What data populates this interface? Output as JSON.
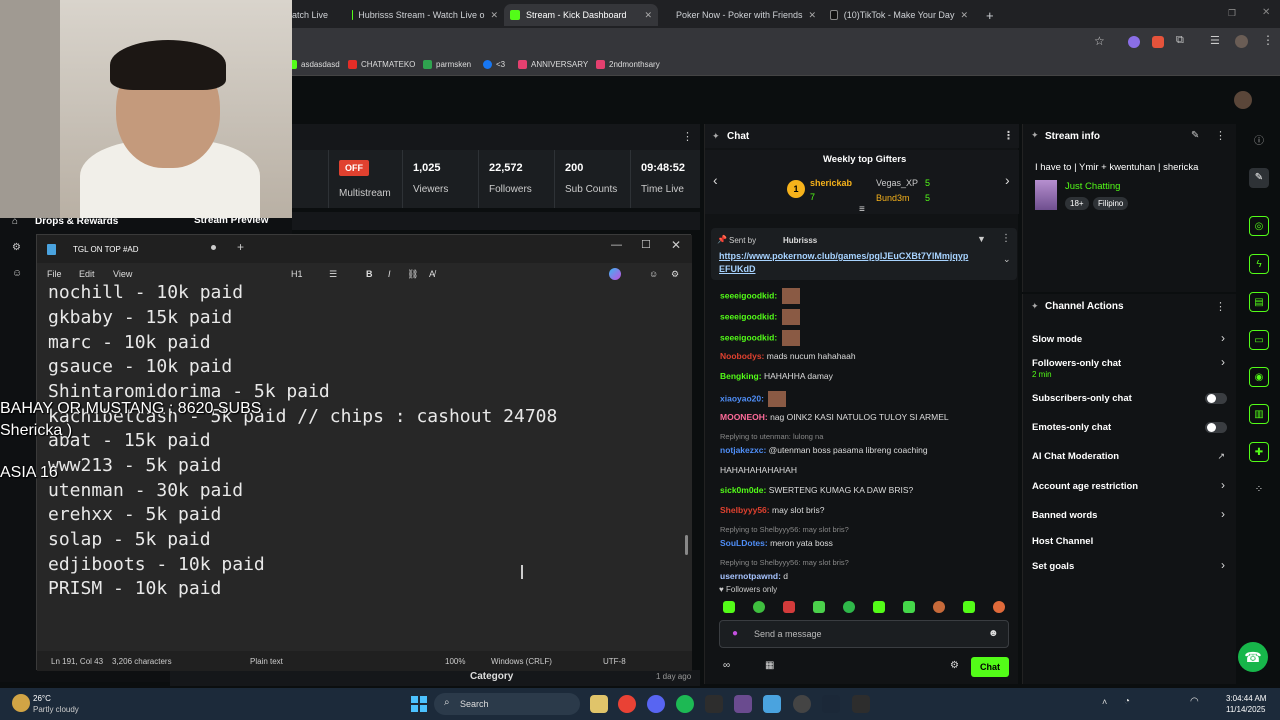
{
  "browser": {
    "tabs": [
      {
        "label": "atch Live",
        "color": "#53fc18"
      },
      {
        "label": "Hubrisss Stream - Watch Live o",
        "color": "#53fc18"
      },
      {
        "label": "Stream - Kick Dashboard",
        "color": "#53fc18"
      },
      {
        "label": "Poker Now - Poker with Friends",
        "color": "#222"
      },
      {
        "label": "(10)TikTok - Make Your Day",
        "color": "#111"
      }
    ],
    "new_tab": "+",
    "bookmarks": [
      "asdasdasd",
      "CHATMATEKO",
      "parmsken",
      "<3",
      "ANNIVERSARY",
      "2ndmonthsary"
    ]
  },
  "dashboard": {
    "drops": "Drops & Rewards",
    "stream_preview": "Stream Preview",
    "offline_badge": "OFF",
    "multistream": "Multistream",
    "stats": [
      {
        "value": "1,025",
        "label": "Viewers"
      },
      {
        "value": "22,572",
        "label": "Followers"
      },
      {
        "value": "200",
        "label": "Sub Counts"
      },
      {
        "value": "09:48:52",
        "label": "Time Live"
      }
    ],
    "category": "Category",
    "time_ago": "1 day ago"
  },
  "overlay": {
    "line1": "BAHAY OR MUSTANG : 8620 SUBS",
    "line2": "Shericka )",
    "line3": "ASIA 16"
  },
  "notepad": {
    "tab_title": "TGL ON TOP #AD",
    "menu": [
      "File",
      "Edit",
      "View"
    ],
    "heading": "H1",
    "lines": [
      "nochill - 10k paid",
      "gkbaby - 15k paid",
      "marc - 10k paid",
      "gsauce - 10k paid",
      "Shintaromidorima - 5k paid",
      "kachibetcash - 5k paid // chips : cashout 24708",
      "abat - 15k paid",
      "www213 - 5k paid",
      "utenman - 30k paid",
      "erehxx - 5k paid",
      "solap - 5k paid",
      "edjiboots - 10k paid",
      "PRISM - 10k paid"
    ],
    "status": {
      "position": "Ln 191, Col 43",
      "chars": "3,206 characters",
      "format": "Plain text",
      "zoom": "100%",
      "eol": "Windows (CRLF)",
      "encoding": "UTF-8"
    }
  },
  "chat": {
    "title": "Chat",
    "gifters_title": "Weekly top Gifters",
    "gifters": [
      {
        "rank": "1",
        "name": "sherickab",
        "count": "7"
      },
      {
        "name": "Vegas_XP",
        "count": "5"
      },
      {
        "name": "Bund3m",
        "count": "5"
      }
    ],
    "pinned_by_label": "Sent by",
    "pinned_by": "Hubrisss",
    "pinned_link": "https://www.pokernow.club/games/pglJEuCXBt7YlMmjqyp",
    "pinned_link2": "EFUKdD",
    "messages": [
      {
        "user": "seeeigoodkid:",
        "text": "",
        "color": "#53fc18"
      },
      {
        "user": "seeeigoodkid:",
        "text": "",
        "color": "#53fc18"
      },
      {
        "user": "seeeigoodkid:",
        "text": "",
        "color": "#53fc18"
      },
      {
        "user": "Noobodys:",
        "text": "mads nucum hahahaah",
        "color": "#e0412f"
      },
      {
        "user": "Bengking:",
        "text": "HAHAHHA damay",
        "color": "#53fc18"
      },
      {
        "user": "xiaoyao20:",
        "text": "",
        "color": "#4f8ef7"
      },
      {
        "user": "MOONEOH:",
        "text": "nag OINK2 KASI NATULOG TULOY SI ARMEL",
        "color": "#ff6b9a"
      },
      {
        "reply": "Replying to utenman: lulong na"
      },
      {
        "user": "notjakezxc:",
        "text": "@utenman boss pasama libreng coaching",
        "color": "#4f8ef7"
      },
      {
        "cont": "HAHAHAHAHAHAH"
      },
      {
        "user": "sick0m0de:",
        "text": "SWERTENG KUMAG KA DAW BRIS?",
        "color": "#53fc18"
      },
      {
        "user": "Shelbyyy56:",
        "text": "may slot bris?",
        "color": "#e0412f"
      },
      {
        "reply": "Replying to Shelbyyy56: may slot bris?"
      },
      {
        "user": "SouLDotes:",
        "text": "meron yata boss",
        "color": "#4f8ef7"
      },
      {
        "reply": "Replying to Shelbyyy56: may slot bris?"
      },
      {
        "user": "usernotpawnd:",
        "text": "d",
        "color": "#a7c4ff"
      }
    ],
    "followers_only": "Followers only",
    "input_placeholder": "Send a message",
    "chat_button": "Chat"
  },
  "stream_info": {
    "title": "Stream info",
    "stream_title": "I have to | Ymir + kwentuhan | shericka",
    "category": "Just Chatting",
    "tags": [
      "18+",
      "Filipino"
    ]
  },
  "channel_actions": {
    "title": "Channel Actions",
    "items": [
      {
        "label": "Slow mode",
        "type": "chevron"
      },
      {
        "label": "Followers-only chat",
        "sub": "2 min",
        "type": "chevron"
      },
      {
        "label": "Subscribers-only chat",
        "type": "toggle"
      },
      {
        "label": "Emotes-only chat",
        "type": "toggle"
      },
      {
        "label": "AI Chat Moderation",
        "type": "external"
      },
      {
        "label": "Account age restriction",
        "type": "chevron"
      },
      {
        "label": "Banned words",
        "type": "chevron"
      },
      {
        "label": "Host Channel",
        "type": "none"
      },
      {
        "label": "Set goals",
        "type": "chevron"
      }
    ]
  },
  "taskbar": {
    "weather_temp": "26°C",
    "weather_desc": "Partly cloudy",
    "search": "Search",
    "time": "3:04:44 AM",
    "date": "11/14/2025"
  }
}
